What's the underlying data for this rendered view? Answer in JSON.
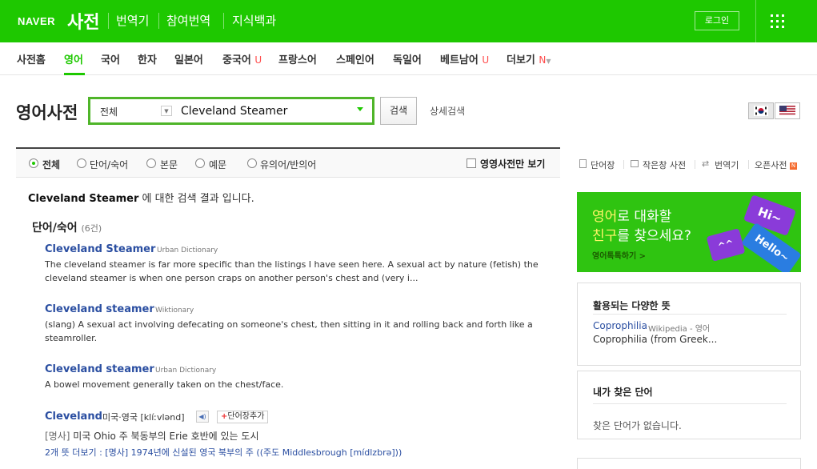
{
  "header": {
    "naver_logo": "NAVER",
    "dict_logo": "사전",
    "nav_links": [
      "번역기",
      "참여번역",
      "지식백과"
    ],
    "login_label": "로그인",
    "apps_icon": "grid-icon"
  },
  "lang_nav": {
    "items": [
      "사전홈",
      "영어",
      "국어",
      "한자",
      "일본어",
      "중국어",
      "프랑스어",
      "스페인어",
      "독일어",
      "베트남어",
      "더보기"
    ],
    "active": "영어",
    "u_mark": "U",
    "n_mark": "N"
  },
  "search": {
    "page_title": "영어사전",
    "scope_value": "전체",
    "query": "Cleveland Steamer",
    "search_button": "검색",
    "advanced_link": "상세검색"
  },
  "filters": {
    "options": [
      "전체",
      "단어/숙어",
      "본문",
      "예문",
      "유의어/반의어"
    ],
    "selected": "전체",
    "checkbox_label": "영영사전만 보기"
  },
  "tools": {
    "wordbook": "단어장",
    "small_dict": "작은창 사전",
    "translator": "번역기",
    "open_dict": "오픈사전",
    "new_badge": "N"
  },
  "results": {
    "summary_query": "Cleveland Steamer",
    "summary_suffix": " 에 대한 검색 결과 입니다.",
    "section_title": "단어/숙어",
    "section_count": "(6건)",
    "entries": [
      {
        "word": "Cleveland Steamer",
        "source": "Urban Dictionary",
        "text": "The cleveland steamer is far more specific than the listings I have seen here. A sexual act by nature (fetish) the cleveland steamer is when one person craps on another person's chest and (very i..."
      },
      {
        "word": "Cleveland steamer",
        "source": "Wiktionary",
        "text": "(slang) A sexual act involving defecating on someone's chest, then sitting in it and rolling back and forth like a steamroller."
      },
      {
        "word": "Cleveland steamer",
        "source": "Urban Dictionary",
        "text": "A bowel movement generally taken on the chest/face."
      }
    ],
    "last_entry": {
      "word": "Cleveland",
      "pronunciation": "미국·영국 [klíːvlənd]",
      "speaker_icon": "speaker-icon",
      "add_button": "단어장추가",
      "pos": "[명사]",
      "meaning": " 미국 Ohio 주 북동부의 Erie 호반에 있는 도시",
      "more": "2개 뜻 더보기 : [명사] 1974년에 신설된 영국 북부의 주 ((주도 Middlesbrough [mídlzbrə]))"
    }
  },
  "sidebar": {
    "banner": {
      "line1_highlight": "영어",
      "line1_rest": "로 대화할",
      "line2_highlight": "친구",
      "line2_rest": "를 찾으세요?",
      "link": "영어톡톡하기 >",
      "bubble_hi": "Hi~",
      "bubble_hello": "Hello~",
      "bubble_face": "^^"
    },
    "meanings_box": {
      "title": "활용되는 다양한 뜻",
      "word": "Coprophilia",
      "source": "Wikipedia - 영어",
      "desc": "Coprophilia (from Greek..."
    },
    "recent_box": {
      "title": "내가 찾은 단어",
      "empty": "찾은 단어가 없습니다."
    }
  },
  "colors": {
    "naver_green": "#1ec800",
    "link_blue": "#2a4ea1",
    "banner_green": "#2fc411",
    "bubble_purple": "#8a3bd9",
    "bubble_blue": "#2a7de1"
  }
}
